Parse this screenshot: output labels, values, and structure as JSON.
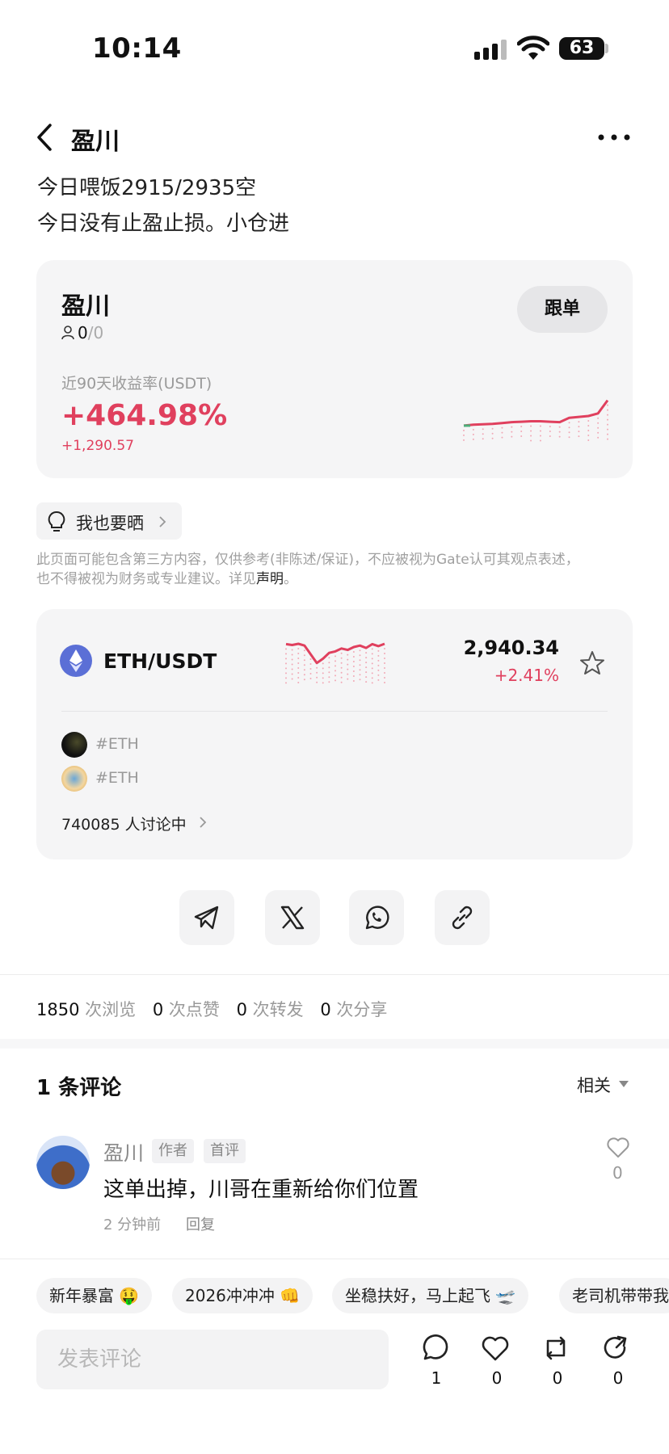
{
  "status": {
    "time": "10:14",
    "battery": "63"
  },
  "header": {
    "title": "盈川"
  },
  "post": {
    "line1": "今日喂饭2915/2935空",
    "line2": "今日没有止盈止损。小仓进"
  },
  "trader_card": {
    "name": "盈川",
    "followers": "0",
    "followers_max": "/0",
    "follow_label": "跟单",
    "yield_label": "近90天收益率(USDT)",
    "yield_pct": "+464.98%",
    "yield_abs": "+1,290.57",
    "colors": {
      "up": "#e0405e",
      "start": "#4caf7a"
    },
    "chart_points": [
      0.02,
      0.04,
      0.05,
      0.06,
      0.08,
      0.1,
      0.11,
      0.12,
      0.12,
      0.11,
      0.1,
      0.2,
      0.22,
      0.24,
      0.3,
      0.6
    ]
  },
  "metoo": {
    "label": "我也要晒"
  },
  "disclaimer": {
    "line1": "此页面可能包含第三方内容，仅供参考(非陈述/保证)，不应被视为Gate认可其观点表述，",
    "line2": "也不得被视为财务或专业建议。详见",
    "link": "声明",
    "end": "。"
  },
  "market_card": {
    "pair": "ETH/USDT",
    "price": "2,940.34",
    "change": "+2.41%",
    "tags": [
      "#ETH",
      "#ETH"
    ],
    "discussion": "740085 人讨论中",
    "mini_points": [
      0.85,
      0.82,
      0.86,
      0.8,
      0.5,
      0.2,
      0.35,
      0.55,
      0.6,
      0.7,
      0.65,
      0.75,
      0.8,
      0.72,
      0.85,
      0.78,
      0.86
    ]
  },
  "share": [
    "telegram-icon",
    "x-icon",
    "whatsapp-icon",
    "link-icon"
  ],
  "stats": {
    "views": "1850",
    "views_label": "次浏览",
    "likes": "0",
    "likes_label": "次点赞",
    "reposts": "0",
    "reposts_label": "次转发",
    "shares": "0",
    "shares_label": "次分享"
  },
  "comments": {
    "title": "1 条评论",
    "sort": "相关",
    "items": [
      {
        "author": "盈川",
        "badges": [
          "作者",
          "首评"
        ],
        "text": "这单出掉，川哥在重新给你们位置",
        "time": "2 分钟前",
        "reply": "回复",
        "likes": "0"
      }
    ]
  },
  "chips": [
    "新年暴富 🤑",
    "2026冲冲冲 👊",
    "坐稳扶好，马上起飞 🛫",
    "老司机带带我"
  ],
  "bottom": {
    "placeholder": "发表评论",
    "comment_count": "1",
    "like_count": "0",
    "repost_count": "0",
    "share_count": "0"
  }
}
